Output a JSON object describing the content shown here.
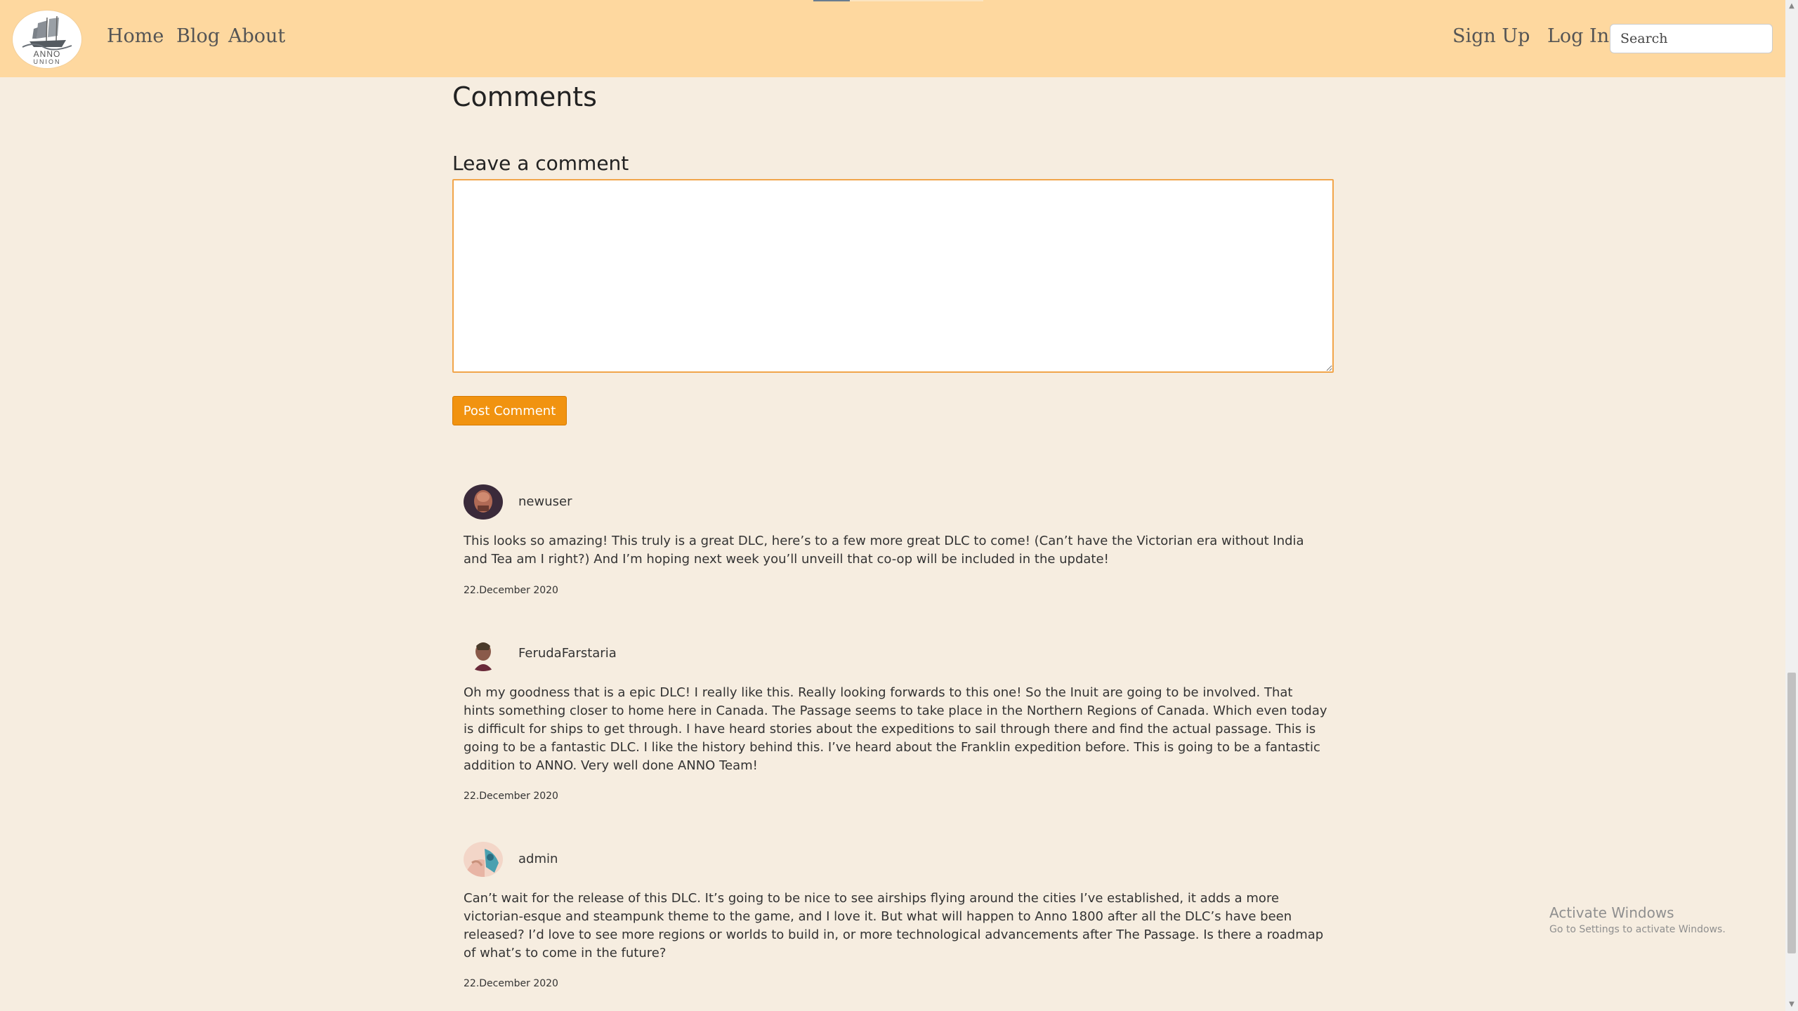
{
  "nav": {
    "logo_text_top": "ANNO",
    "logo_text_bottom": "UNION",
    "links": [
      "Home",
      "Blog",
      "About"
    ],
    "sign_up": "Sign Up",
    "log_in": "Log In",
    "search_placeholder": "Search"
  },
  "comments_section": {
    "title": "Comments",
    "leave_comment": "Leave a comment",
    "post_button": "Post Comment"
  },
  "comments": [
    {
      "username": "newuser",
      "text": "This looks so amazing! This truly is a great DLC, here’s to a few more great DLC to come! (Can’t have the Victorian era without India and Tea am I right?) And I’m hoping next week you’ll unveill that co-op will be included in the update!",
      "date": "22.December 2020"
    },
    {
      "username": "FerudaFarstaria",
      "text": "Oh my goodness that is a epic DLC! I really like this. Really looking forwards to this one! So the Inuit are going to be involved. That hints something closer to home here in Canada. The Passage seems to take place in the Northern Regions of Canada. Which even today is difficult for ships to get through. I have heard stories about the expeditions to sail through there and find the actual passage. This is going to be a fantastic DLC. I like the history behind this. I’ve heard about the Franklin expedition before. This is going to be a fantastic addition to ANNO. Very well done ANNO Team!",
      "date": "22.December 2020"
    },
    {
      "username": "admin",
      "text": "Can’t wait for the release of this DLC. It’s going to be nice to see airships flying around the cities I’ve established, it adds a more victorian-esque and steampunk theme to the game, and I love it. But what will happen to Anno 1800 after all the DLC’s have been released? I’d love to see more regions or worlds to build in, or more technological advancements after The Passage. Is there a roadmap of what’s to come in the future?",
      "date": "22.December 2020"
    }
  ],
  "watermark": {
    "title": "Activate Windows",
    "subtitle": "Go to Settings to activate Windows."
  },
  "colors": {
    "nav_bg": "#fed89f",
    "page_bg": "#f6ede0",
    "accent": "#f19310"
  }
}
